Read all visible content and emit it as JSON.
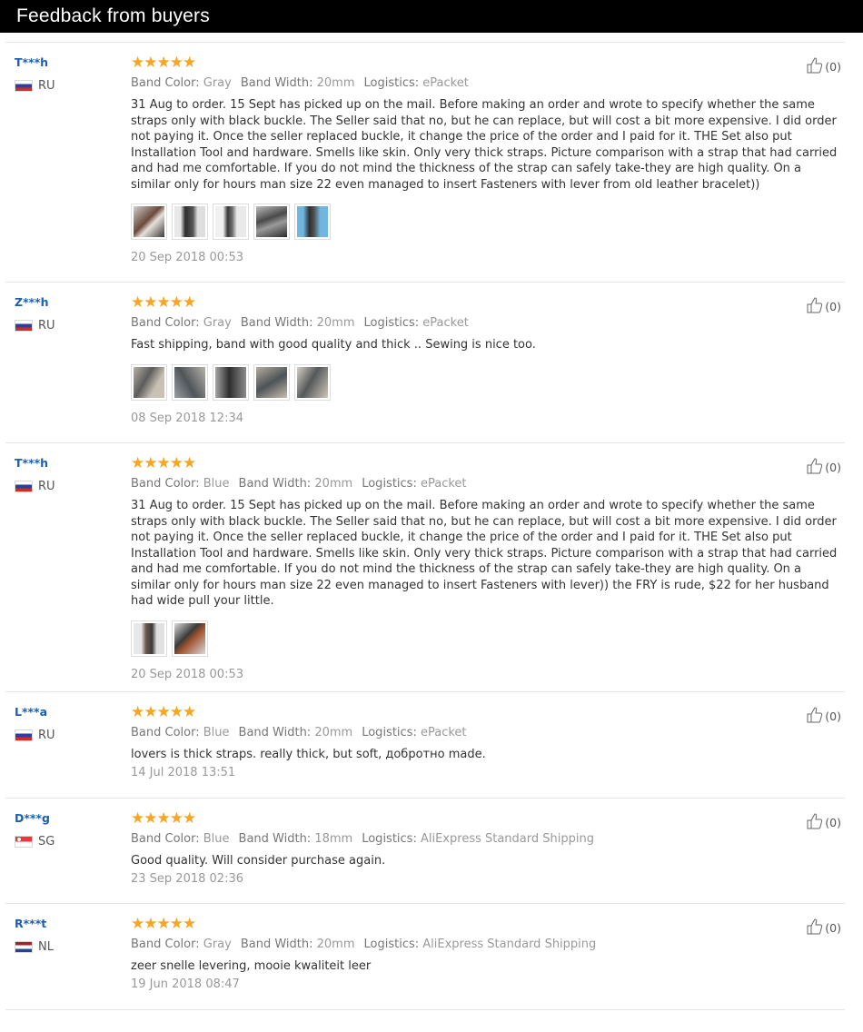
{
  "header": {
    "title": "Feedback from buyers"
  },
  "labels": {
    "band_color": "Band Color:",
    "band_width": "Band Width:",
    "logistics": "Logistics:"
  },
  "stars": "★★★★★",
  "reviews": [
    {
      "user": "T***h",
      "country": "RU",
      "flag": "ru",
      "band_color": "Gray",
      "band_width": "20mm",
      "logistics": "ePacket",
      "text": "31 Aug to order. 15 Sept has picked up on the mail. Before making an order and wrote to specify whether the same straps only with black buckle. The Seller said that no, but he can replace, but will cost a bit more expensive. I did order not paying it. Once the seller replaced buckle, it change the price of the order and I paid for it. THE Set also put Installation Tool and hardware. Smells like skin. Only very thick straps. Picture comparison with a strap that had carried and had me comfortable. If you do not mind the thickness of the strap can safely take-they are high quality. On a similar only for hours man size 22 even managed to insert Fasteners with lever from old leather bracelet))",
      "date": "20 Sep 2018 00:53",
      "helpful": "(0)",
      "photos": 5
    },
    {
      "user": "Z***h",
      "country": "RU",
      "flag": "ru",
      "band_color": "Gray",
      "band_width": "20mm",
      "logistics": "ePacket",
      "text": "Fast shipping, band with good quality and thick .. Sewing is nice too.",
      "date": "08 Sep 2018 12:34",
      "helpful": "(0)",
      "photos": 5
    },
    {
      "user": "T***h",
      "country": "RU",
      "flag": "ru",
      "band_color": "Blue",
      "band_width": "20mm",
      "logistics": "ePacket",
      "text": "31 Aug to order. 15 Sept has picked up on the mail. Before making an order and wrote to specify whether the same straps only with black buckle. The Seller said that no, but he can replace, but will cost a bit more expensive. I did order not paying it. Once the seller replaced buckle, it change the price of the order and I paid for it. THE Set also put Installation Tool and hardware. Smells like skin. Only very thick straps. Picture comparison with a strap that had carried and had me comfortable. If you do not mind the thickness of the strap can safely take-they are high quality. On a similar only for hours man size 22 even managed to insert Fasteners with lever)) the FRY is rude, $22 for her husband had wide pull your little.",
      "date": "20 Sep 2018 00:53",
      "helpful": "(0)",
      "photos": 2
    },
    {
      "user": "L***a",
      "country": "RU",
      "flag": "ru",
      "band_color": "Blue",
      "band_width": "20mm",
      "logistics": "ePacket",
      "text": "lovers is thick straps. really thick, but soft, добротно made.",
      "date": "14 Jul 2018 13:51",
      "helpful": "(0)",
      "photos": 0
    },
    {
      "user": "D***g",
      "country": "SG",
      "flag": "sg",
      "band_color": "Blue",
      "band_width": "18mm",
      "logistics": "AliExpress Standard Shipping",
      "text": "Good quality. Will consider purchase again.",
      "date": "23 Sep 2018 02:36",
      "helpful": "(0)",
      "photos": 0
    },
    {
      "user": "R***t",
      "country": "NL",
      "flag": "nl",
      "band_color": "Gray",
      "band_width": "20mm",
      "logistics": "AliExpress Standard Shipping",
      "text": "zeer snelle levering, mooie kwaliteit leer",
      "date": "19 Jun 2018 08:47",
      "helpful": "(0)",
      "photos": 0
    }
  ]
}
